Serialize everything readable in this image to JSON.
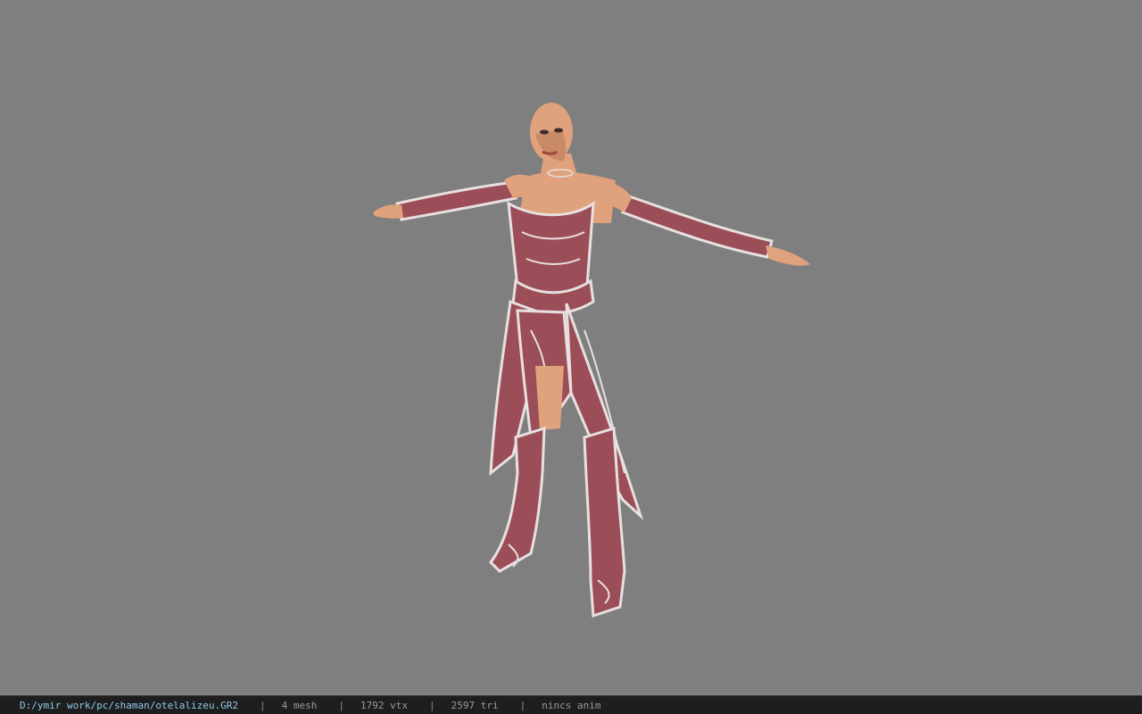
{
  "viewport": {
    "background": "#7f7f7f",
    "model_description_icon": "t-pose-character-model"
  },
  "status": {
    "file_path": "D:/ymir work/pc/shaman/otelalizeu.GR2",
    "separator": "|",
    "mesh": "4 mesh",
    "vertices": "1792 vtx",
    "triangles": "2597 tri",
    "animation": "nincs anim"
  },
  "colors": {
    "statusbar_bg": "#1e1e1e",
    "path_color": "#8ec9e8",
    "dress_color": "#9b4e57",
    "trim_color": "#e8e0e0",
    "skin_color": "#e0a27d"
  }
}
